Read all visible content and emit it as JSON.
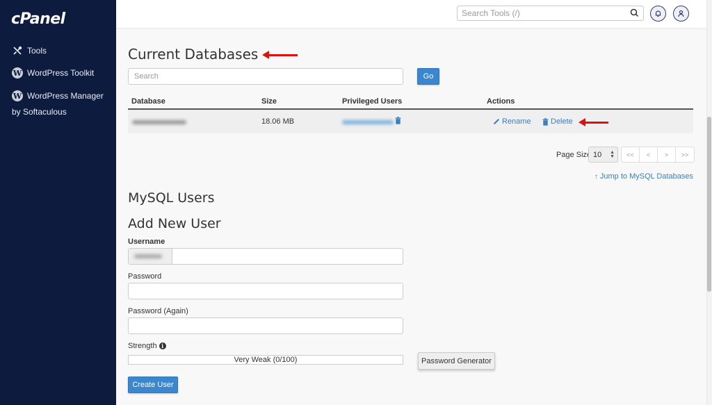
{
  "sidebar": {
    "logo": "cPanel",
    "items": [
      {
        "label": "Tools",
        "icon": "tools-icon"
      },
      {
        "label": "WordPress Toolkit",
        "icon": "wordpress-icon"
      },
      {
        "label": "WordPress Manager",
        "icon": "wordpress-icon",
        "sublabel": "by Softaculous"
      }
    ]
  },
  "header": {
    "search_placeholder": "Search Tools (/)",
    "icons": [
      "search-icon",
      "bell-icon",
      "user-icon"
    ]
  },
  "current_databases": {
    "title": "Current Databases",
    "search_placeholder": "Search",
    "go_label": "Go",
    "columns": [
      "Database",
      "Size",
      "Privileged Users",
      "Actions"
    ],
    "rows": [
      {
        "database": "[redacted]",
        "size": "18.06 MB",
        "privileged_user": "[redacted]",
        "actions": [
          "Rename",
          "Delete"
        ]
      }
    ],
    "page_size_label": "Page Size",
    "page_size": "10",
    "pager": [
      "<<",
      "<",
      ">",
      ">>"
    ],
    "jump_link": "Jump to MySQL Databases"
  },
  "mysql_users": {
    "title": "MySQL Users",
    "add_title": "Add New User",
    "username_label": "Username",
    "username_value": "",
    "password_label": "Password",
    "password_again_label": "Password (Again)",
    "strength_label": "Strength",
    "strength_text": "Very Weak (0/100)",
    "strength_score": 0,
    "password_generator_label": "Password Generator",
    "create_user_label": "Create User"
  },
  "annotations": {
    "arrow_color": "#e01010"
  }
}
